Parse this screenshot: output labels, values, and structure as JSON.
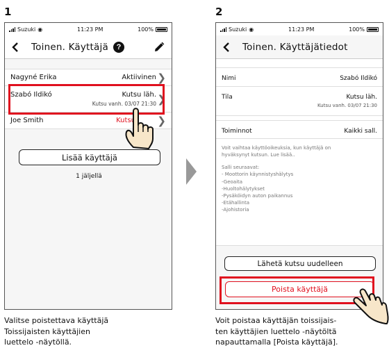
{
  "step1": {
    "number": "1",
    "statusbar": {
      "carrier": "Suzuki",
      "time": "11:23 PM",
      "battery": "100%"
    },
    "nav": {
      "back": "<",
      "title": "Toinen. Käyttäjä",
      "help": "?"
    },
    "users": [
      {
        "name": "Nagyné Erika",
        "status": "Aktiivinen",
        "sub": ""
      },
      {
        "name": "Szabó Ildikó",
        "status": "Kutsu läh.",
        "sub": "Kutsu vanh. 03/07 21:30"
      },
      {
        "name": "Joe Smith",
        "status": "Kutsu",
        "sub": ""
      }
    ],
    "add_user_label": "Lisää käyttäjä",
    "remaining": "1 jäljellä",
    "caption": [
      "Valitse poistettava käyttäjä",
      "Toissijaisten käyttäjien",
      "luettelo -näytöllä."
    ]
  },
  "step2": {
    "number": "2",
    "statusbar": {
      "carrier": "Suzuki",
      "time": "11:23 PM",
      "battery": "100%"
    },
    "nav": {
      "back": "<",
      "title": "Toinen. Käyttäjätiedot"
    },
    "name_label": "Nimi",
    "name_value": "Szabó Ildikó",
    "status_label": "Tila",
    "status_value": "Kutsu läh.",
    "status_sub": "Kutsu vanh. 03/07 21:30",
    "actions_label": "Toiminnot",
    "actions_value": "Kaikki sall.",
    "permissions_note": [
      "Voit vaihtaa käyttöoikeuksia, kun käyttäjä on",
      "hyväksynyt kutsun. Lue lisää.."
    ],
    "allowed_heading": "Salli seuraavat:",
    "allowed_items": [
      "- Moottorin käynnistyshälytys",
      "-Geoaita",
      "-Huoltohälytykset",
      "-Pysäköidyn auton paikannus",
      "-Etähallinta",
      "-Ajohistoria"
    ],
    "resend_label": "Lähetä kutsu uudelleen",
    "delete_label": "Poista käyttäjä",
    "caption": [
      "Voit poistaa käyttäjän toissijais-",
      "ten käyttäjien luettelo -näytöltä",
      "napauttamalla [Poista käyttäjä]."
    ]
  },
  "colors": {
    "accent_red": "#e0101e",
    "arrow": "#999999",
    "hand_fill": "#f7e6c9"
  },
  "icons": {
    "edit": "pencil-icon",
    "help": "question-circle-icon",
    "back": "chevron-left-icon",
    "row": "chevron-right-icon",
    "pointer": "pointing-hand-icon"
  }
}
